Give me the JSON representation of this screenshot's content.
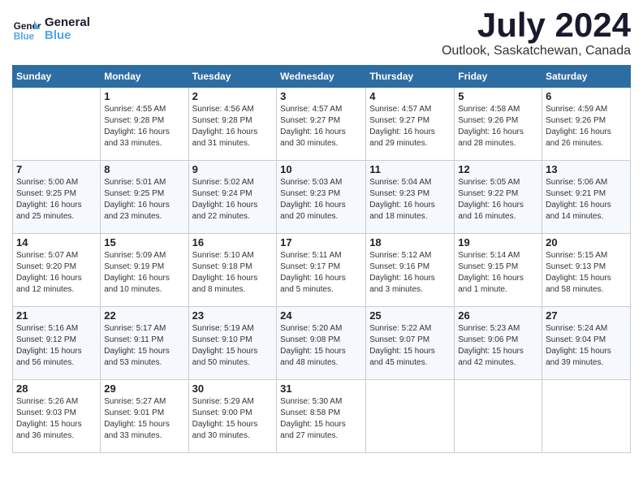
{
  "app": {
    "name": "GeneralBlue",
    "logo_line1": "General",
    "logo_line2": "Blue"
  },
  "title": {
    "month_year": "July 2024",
    "location": "Outlook, Saskatchewan, Canada"
  },
  "columns": [
    "Sunday",
    "Monday",
    "Tuesday",
    "Wednesday",
    "Thursday",
    "Friday",
    "Saturday"
  ],
  "weeks": [
    [
      {
        "day": "",
        "info": ""
      },
      {
        "day": "1",
        "info": "Sunrise: 4:55 AM\nSunset: 9:28 PM\nDaylight: 16 hours\nand 33 minutes."
      },
      {
        "day": "2",
        "info": "Sunrise: 4:56 AM\nSunset: 9:28 PM\nDaylight: 16 hours\nand 31 minutes."
      },
      {
        "day": "3",
        "info": "Sunrise: 4:57 AM\nSunset: 9:27 PM\nDaylight: 16 hours\nand 30 minutes."
      },
      {
        "day": "4",
        "info": "Sunrise: 4:57 AM\nSunset: 9:27 PM\nDaylight: 16 hours\nand 29 minutes."
      },
      {
        "day": "5",
        "info": "Sunrise: 4:58 AM\nSunset: 9:26 PM\nDaylight: 16 hours\nand 28 minutes."
      },
      {
        "day": "6",
        "info": "Sunrise: 4:59 AM\nSunset: 9:26 PM\nDaylight: 16 hours\nand 26 minutes."
      }
    ],
    [
      {
        "day": "7",
        "info": "Sunrise: 5:00 AM\nSunset: 9:25 PM\nDaylight: 16 hours\nand 25 minutes."
      },
      {
        "day": "8",
        "info": "Sunrise: 5:01 AM\nSunset: 9:25 PM\nDaylight: 16 hours\nand 23 minutes."
      },
      {
        "day": "9",
        "info": "Sunrise: 5:02 AM\nSunset: 9:24 PM\nDaylight: 16 hours\nand 22 minutes."
      },
      {
        "day": "10",
        "info": "Sunrise: 5:03 AM\nSunset: 9:23 PM\nDaylight: 16 hours\nand 20 minutes."
      },
      {
        "day": "11",
        "info": "Sunrise: 5:04 AM\nSunset: 9:23 PM\nDaylight: 16 hours\nand 18 minutes."
      },
      {
        "day": "12",
        "info": "Sunrise: 5:05 AM\nSunset: 9:22 PM\nDaylight: 16 hours\nand 16 minutes."
      },
      {
        "day": "13",
        "info": "Sunrise: 5:06 AM\nSunset: 9:21 PM\nDaylight: 16 hours\nand 14 minutes."
      }
    ],
    [
      {
        "day": "14",
        "info": "Sunrise: 5:07 AM\nSunset: 9:20 PM\nDaylight: 16 hours\nand 12 minutes."
      },
      {
        "day": "15",
        "info": "Sunrise: 5:09 AM\nSunset: 9:19 PM\nDaylight: 16 hours\nand 10 minutes."
      },
      {
        "day": "16",
        "info": "Sunrise: 5:10 AM\nSunset: 9:18 PM\nDaylight: 16 hours\nand 8 minutes."
      },
      {
        "day": "17",
        "info": "Sunrise: 5:11 AM\nSunset: 9:17 PM\nDaylight: 16 hours\nand 5 minutes."
      },
      {
        "day": "18",
        "info": "Sunrise: 5:12 AM\nSunset: 9:16 PM\nDaylight: 16 hours\nand 3 minutes."
      },
      {
        "day": "19",
        "info": "Sunrise: 5:14 AM\nSunset: 9:15 PM\nDaylight: 16 hours\nand 1 minute."
      },
      {
        "day": "20",
        "info": "Sunrise: 5:15 AM\nSunset: 9:13 PM\nDaylight: 15 hours\nand 58 minutes."
      }
    ],
    [
      {
        "day": "21",
        "info": "Sunrise: 5:16 AM\nSunset: 9:12 PM\nDaylight: 15 hours\nand 56 minutes."
      },
      {
        "day": "22",
        "info": "Sunrise: 5:17 AM\nSunset: 9:11 PM\nDaylight: 15 hours\nand 53 minutes."
      },
      {
        "day": "23",
        "info": "Sunrise: 5:19 AM\nSunset: 9:10 PM\nDaylight: 15 hours\nand 50 minutes."
      },
      {
        "day": "24",
        "info": "Sunrise: 5:20 AM\nSunset: 9:08 PM\nDaylight: 15 hours\nand 48 minutes."
      },
      {
        "day": "25",
        "info": "Sunrise: 5:22 AM\nSunset: 9:07 PM\nDaylight: 15 hours\nand 45 minutes."
      },
      {
        "day": "26",
        "info": "Sunrise: 5:23 AM\nSunset: 9:06 PM\nDaylight: 15 hours\nand 42 minutes."
      },
      {
        "day": "27",
        "info": "Sunrise: 5:24 AM\nSunset: 9:04 PM\nDaylight: 15 hours\nand 39 minutes."
      }
    ],
    [
      {
        "day": "28",
        "info": "Sunrise: 5:26 AM\nSunset: 9:03 PM\nDaylight: 15 hours\nand 36 minutes."
      },
      {
        "day": "29",
        "info": "Sunrise: 5:27 AM\nSunset: 9:01 PM\nDaylight: 15 hours\nand 33 minutes."
      },
      {
        "day": "30",
        "info": "Sunrise: 5:29 AM\nSunset: 9:00 PM\nDaylight: 15 hours\nand 30 minutes."
      },
      {
        "day": "31",
        "info": "Sunrise: 5:30 AM\nSunset: 8:58 PM\nDaylight: 15 hours\nand 27 minutes."
      },
      {
        "day": "",
        "info": ""
      },
      {
        "day": "",
        "info": ""
      },
      {
        "day": "",
        "info": ""
      }
    ]
  ]
}
